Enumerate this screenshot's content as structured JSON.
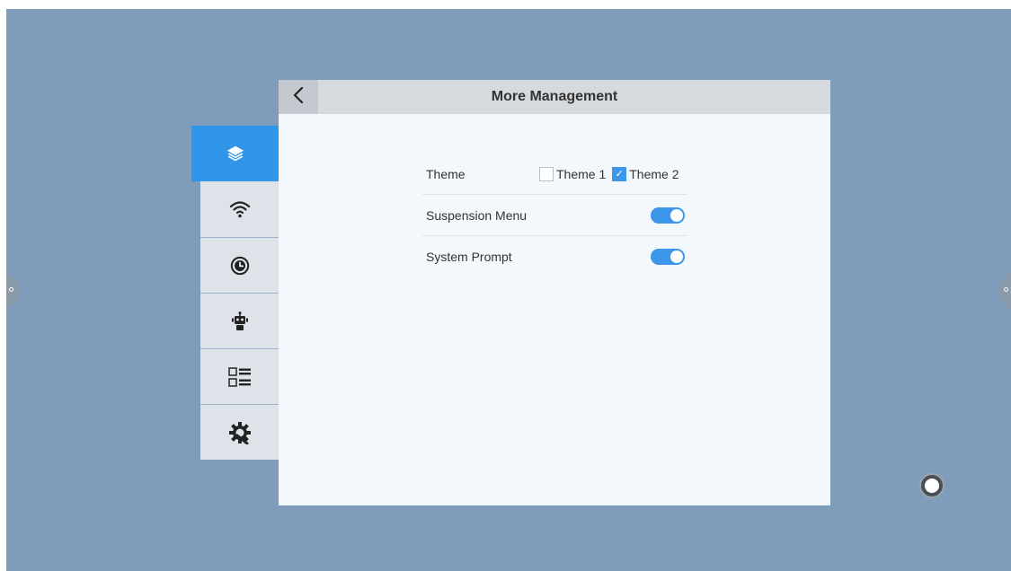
{
  "window": {
    "title": "More Management",
    "back_icon": "chevron-left-icon"
  },
  "sidebar": {
    "items": [
      {
        "icon": "layers-icon",
        "active": true
      },
      {
        "icon": "wifi-icon",
        "active": false
      },
      {
        "icon": "clock-icon",
        "active": false
      },
      {
        "icon": "robot-icon",
        "active": false
      },
      {
        "icon": "list-icon",
        "active": false
      },
      {
        "icon": "gear-wrench-icon",
        "active": false
      }
    ]
  },
  "settings": {
    "theme": {
      "label": "Theme",
      "options": [
        {
          "label": "Theme 1",
          "checked": false
        },
        {
          "label": "Theme 2",
          "checked": true
        }
      ]
    },
    "suspension_menu": {
      "label": "Suspension Menu",
      "enabled": true
    },
    "system_prompt": {
      "label": "System Prompt",
      "enabled": true
    }
  },
  "colors": {
    "accent": "#2f96ea",
    "desktop_bg": "#7f9cbb",
    "panel_bg": "#f3f8fc",
    "header_bg": "#d5dade"
  }
}
